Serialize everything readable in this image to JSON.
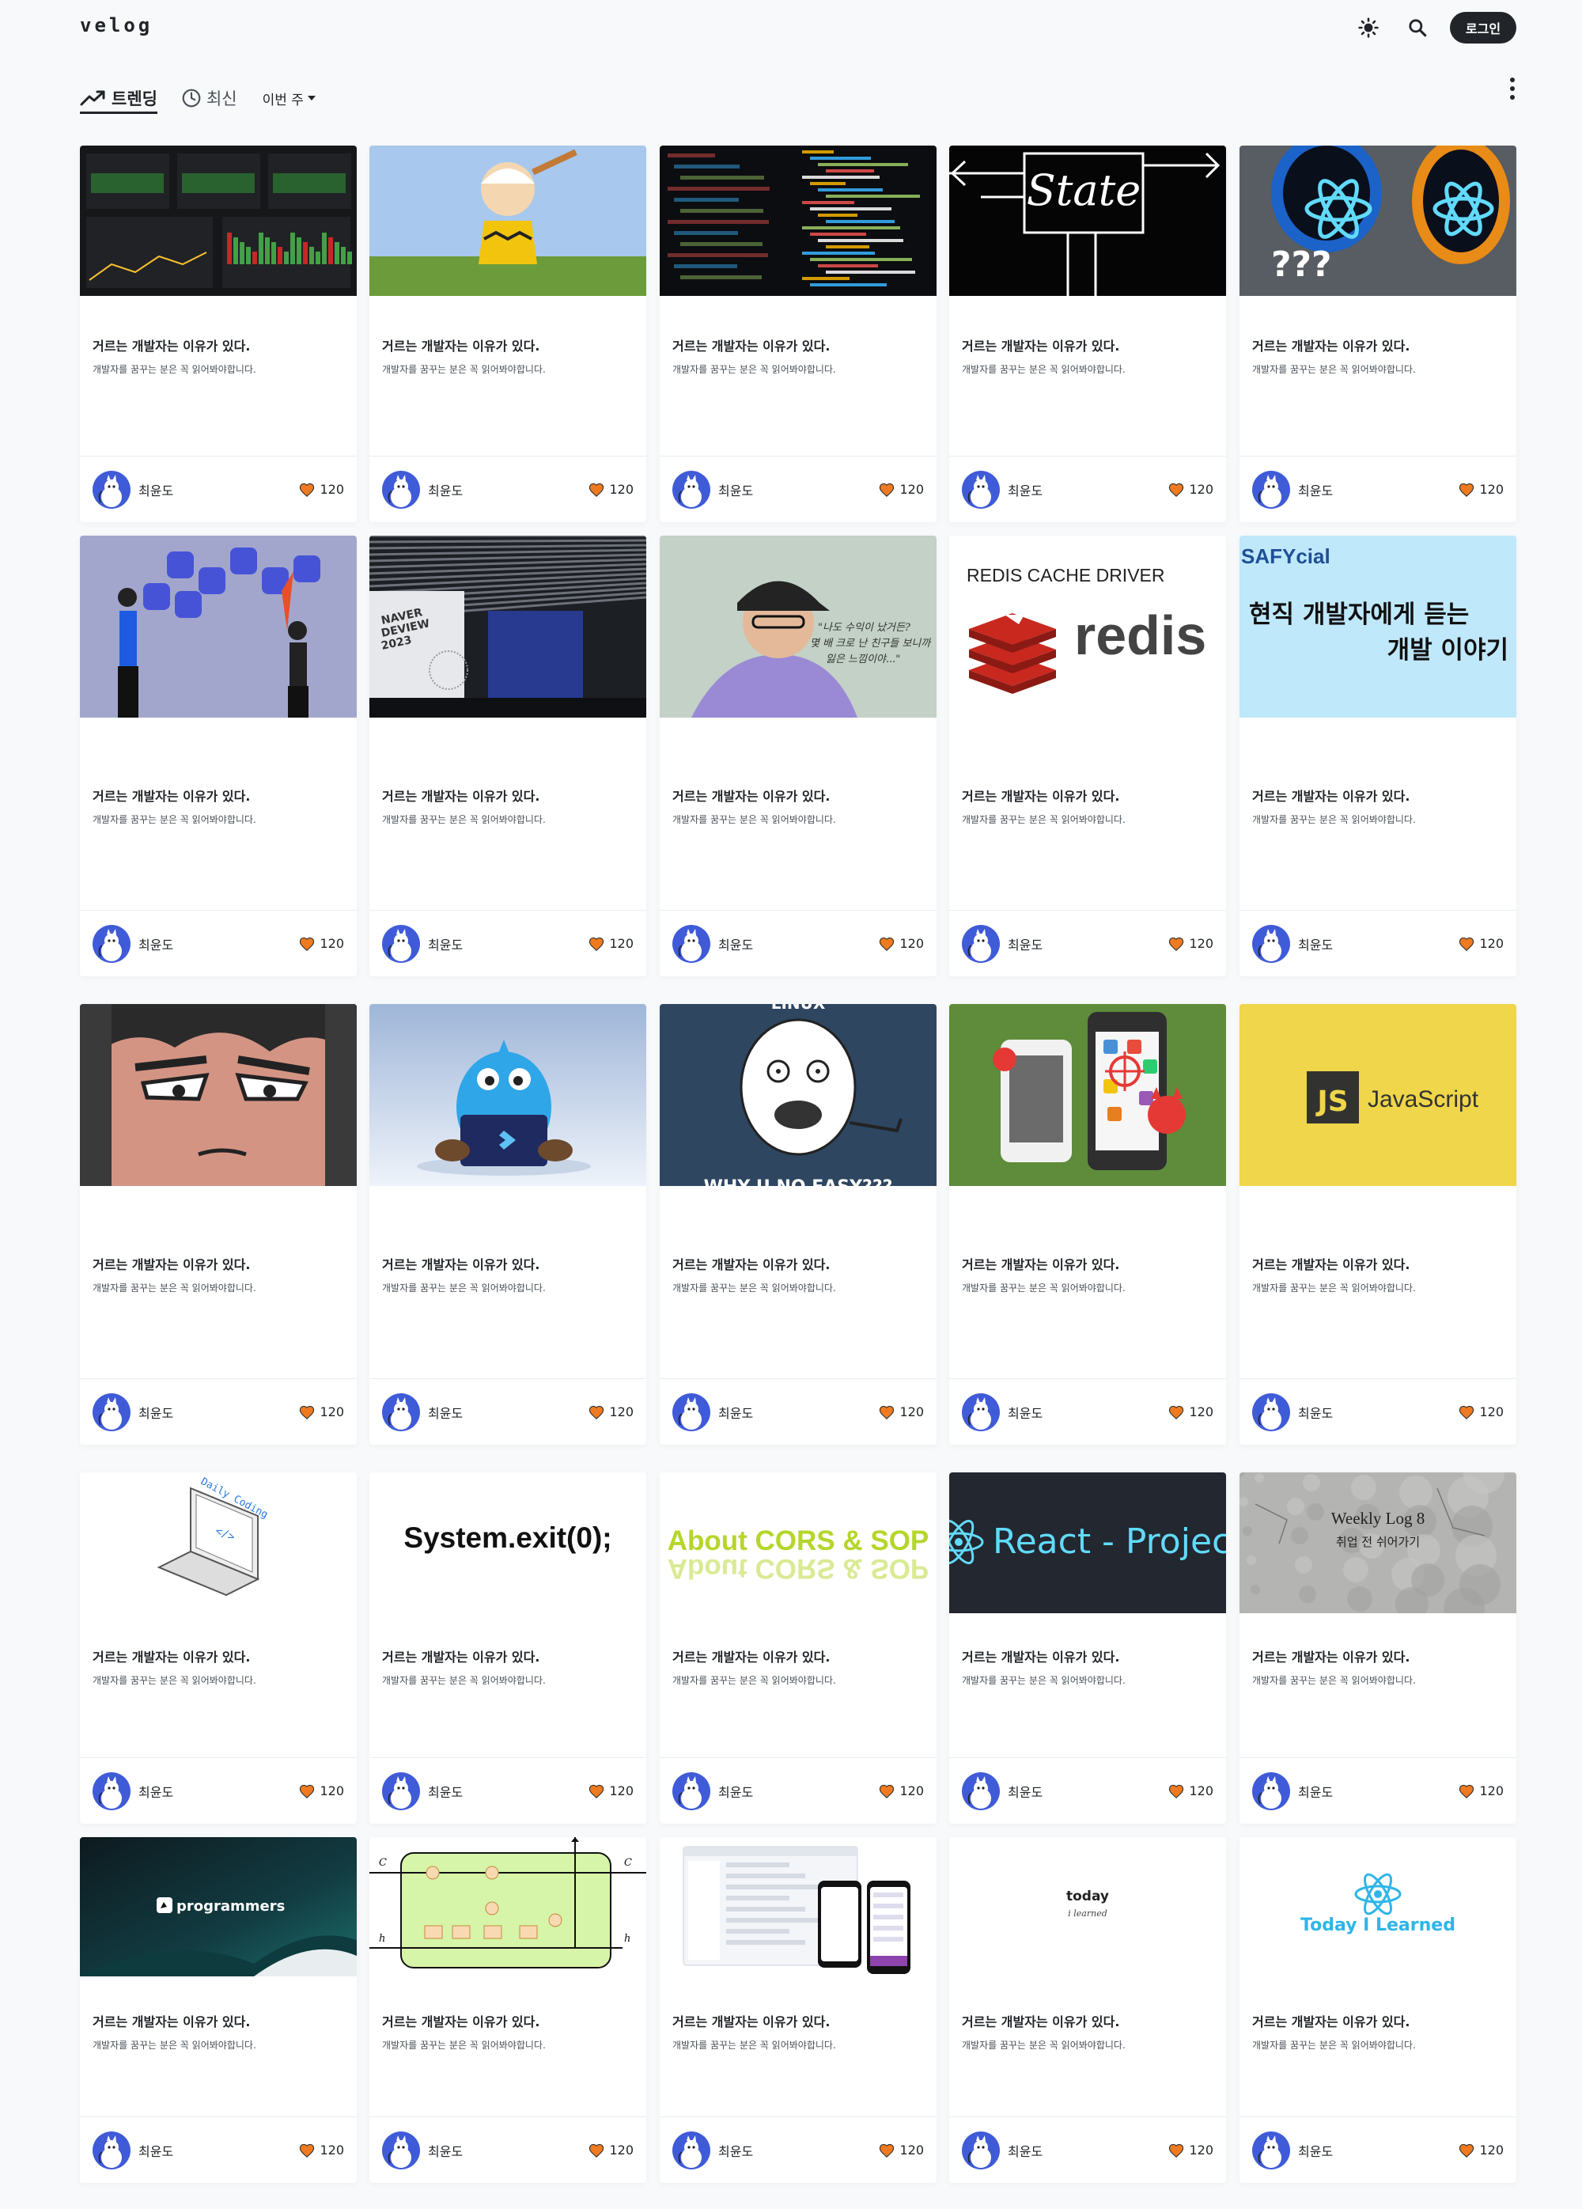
{
  "header": {
    "logo": "velog",
    "login_label": "로그인"
  },
  "filters": {
    "trending_label": "트렌딩",
    "recent_label": "최신",
    "period_label": "이번 주"
  },
  "colors": {
    "background": "#f8f9fa",
    "heart": "#ef7a1f",
    "avatar_bg": "#3f5bd8",
    "dark_button": "#212529"
  },
  "post_template": {
    "title": "거르는 개발자는 이유가 있다.",
    "description": "개발자를 꿈꾸는 분은 꼭 읽어봐야합니다.",
    "author": "최윤도",
    "likes": "120"
  },
  "thumbnails": [
    {
      "theme": "grafana-dashboard"
    },
    {
      "theme": "charlie-brown-cartoon"
    },
    {
      "theme": "code-editor-dark"
    },
    {
      "theme": "state-chalk-drawing"
    },
    {
      "theme": "react-portal",
      "texts": [
        "???"
      ]
    },
    {
      "theme": "people-with-speech-bubbles"
    },
    {
      "theme": "naver-deview-conference",
      "texts": [
        "NAVER",
        "DEVIEW",
        "2023"
      ]
    },
    {
      "theme": "person-with-cap",
      "texts": [
        "\"나도 수익이 났거든?",
        "몇 배 크로 난 친구들 보니까",
        "잃은 느낌이야...\""
      ]
    },
    {
      "theme": "redis-logo",
      "texts": [
        "REDIS CACHE DRIVER",
        "redis"
      ]
    },
    {
      "theme": "safycial-banner",
      "texts": [
        "SAFYcial",
        "현직 개발자에게 듣는",
        "개발 이야기"
      ]
    },
    {
      "theme": "anime-face"
    },
    {
      "theme": "flutter-dash-mascot"
    },
    {
      "theme": "y-u-no-meme",
      "texts": [
        "LINUX",
        "WHY U NO EASY???"
      ]
    },
    {
      "theme": "mobile-security"
    },
    {
      "theme": "javascript-logo",
      "texts": [
        "JS",
        "JavaScript"
      ]
    },
    {
      "theme": "laptop-daily-coding",
      "texts": [
        "Daily Coding"
      ]
    },
    {
      "theme": "system-exit",
      "texts": [
        "System.exit(0);"
      ]
    },
    {
      "theme": "cors-sop",
      "texts": [
        "About CORS & SOP"
      ]
    },
    {
      "theme": "react-project",
      "texts": [
        "React - Projec"
      ]
    },
    {
      "theme": "weekly-log",
      "texts": [
        "Weekly Log 8",
        "취업 전 쉬어가기"
      ]
    },
    {
      "theme": "programmers",
      "texts": [
        "programmers"
      ]
    },
    {
      "theme": "lstm-diagram"
    },
    {
      "theme": "app-screens"
    },
    {
      "theme": "til-minimal",
      "texts": [
        "today",
        "i learned"
      ]
    },
    {
      "theme": "react-til",
      "texts": [
        "Today I Learned"
      ]
    }
  ]
}
